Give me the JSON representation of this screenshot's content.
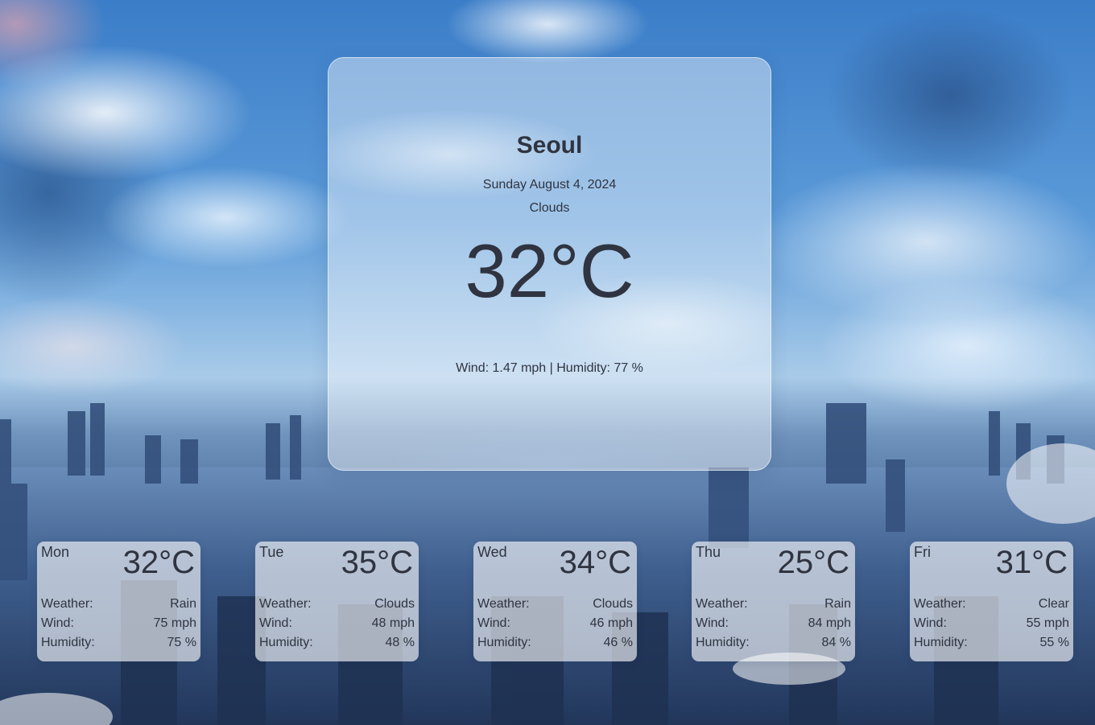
{
  "current": {
    "city": "Seoul",
    "date": "Sunday August 4, 2024",
    "condition": "Clouds",
    "temperature": "32°C",
    "details": "Wind: 1.47 mph | Humidity: 77 %"
  },
  "forecast_labels": {
    "weather": "Weather:",
    "wind": "Wind:",
    "humidity": "Humidity:"
  },
  "forecast": [
    {
      "day": "Mon",
      "temp": "32°C",
      "weather": "Rain",
      "wind": "75 mph",
      "humidity": "75 %"
    },
    {
      "day": "Tue",
      "temp": "35°C",
      "weather": "Clouds",
      "wind": "48 mph",
      "humidity": "48 %"
    },
    {
      "day": "Wed",
      "temp": "34°C",
      "weather": "Clouds",
      "wind": "46 mph",
      "humidity": "46 %"
    },
    {
      "day": "Thu",
      "temp": "25°C",
      "weather": "Rain",
      "wind": "84 mph",
      "humidity": "84 %"
    },
    {
      "day": "Fri",
      "temp": "31°C",
      "weather": "Clear",
      "wind": "55 mph",
      "humidity": "55 %"
    }
  ],
  "colors": {
    "text": "#2f3440",
    "sky": "#5b9ad8",
    "city": "#2b4266"
  }
}
